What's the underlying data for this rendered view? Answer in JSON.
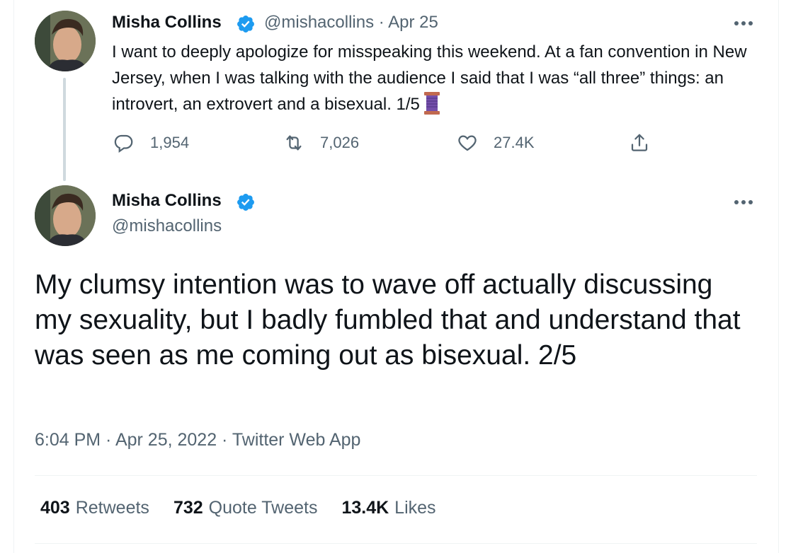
{
  "tweet1": {
    "author_name": "Misha Collins",
    "handle": "@mishacollins",
    "separator": "·",
    "date": "Apr 25",
    "text": "I want to deeply apologize for misspeaking this weekend. At a fan convention in New Jersey, when I was talking with the audience I said that I was “all three” things: an introvert, an extrovert and a bisexual.  1/5",
    "emoji": "thread-spool-icon",
    "actions": {
      "replies": "1,954",
      "retweets": "7,026",
      "likes": "27.4K"
    }
  },
  "tweet2": {
    "author_name": "Misha Collins",
    "handle": "@mishacollins",
    "text": "My clumsy intention was to wave off actually discussing my sexuality, but I badly fumbled that and understand that was seen as me coming out as bisexual. 2/5",
    "meta": "6:04 PM · Apr 25, 2022 · Twitter Web App",
    "stats": {
      "retweets_count": "403",
      "retweets_label": "Retweets",
      "quotes_count": "732",
      "quotes_label": "Quote Tweets",
      "likes_count": "13.4K",
      "likes_label": "Likes"
    }
  },
  "colors": {
    "verified": "#1d9bf0",
    "secondary_text": "#536471",
    "thread_line": "#cfd9de"
  }
}
